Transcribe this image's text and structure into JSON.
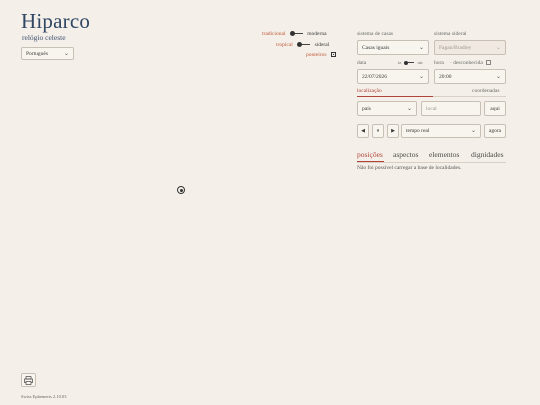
{
  "app": {
    "title": "Hiparco",
    "subtitle": "relógio celeste"
  },
  "language": {
    "selected": "Português"
  },
  "toggles": {
    "row1": {
      "left": "tradicional",
      "right": "moderna"
    },
    "row2": {
      "left": "tropical",
      "right": "sideral"
    },
    "row3": {
      "label": "ponteiros",
      "checked": true
    }
  },
  "settings": {
    "house_system_label": "sistema de casas",
    "house_system_value": "Casas iguais",
    "sidereal_label": "sistema sideral",
    "sidereal_value": "Fagan/Bradley",
    "date_label": "data",
    "tz_left": "tz",
    "tz_right": "utc",
    "time_label": "hora",
    "unknown_label": "desconhecida",
    "date_value": "22/07/2026",
    "time_value": "20:00"
  },
  "location": {
    "title": "localização",
    "coords_label": "coordenadas",
    "country_value": "país",
    "place_placeholder": "local",
    "here_button": "aqui"
  },
  "playback": {
    "prev": "◀",
    "pause": "⏸",
    "next": "▶",
    "mode_value": "tempo real",
    "now_button": "agora"
  },
  "tabs": [
    "posições",
    "aspectos",
    "elementos",
    "dignidades"
  ],
  "status_message": "Não foi possível carregar a base de localidades.",
  "footer": "Swiss Ephemeris 2.10.03",
  "colors": {
    "accent": "#b0433a",
    "title": "#2f4664",
    "background": "#f4efe8"
  }
}
